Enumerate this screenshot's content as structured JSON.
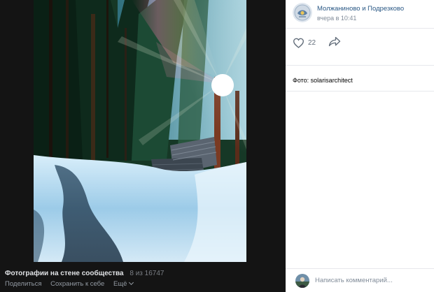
{
  "post": {
    "community_name": "Молжаниново и Подрезково",
    "time": "вчера в 10:41",
    "likes": "22",
    "caption": "Фото: solarisarchitect"
  },
  "viewer": {
    "album_title": "Фотографии на стене сообщества",
    "position": "8 из 16747",
    "share_label": "Поделиться",
    "save_label": "Сохранить к себе",
    "more_label": "Ещё"
  },
  "comment": {
    "placeholder": "Написать комментарий..."
  },
  "colors": {
    "viewer_bg": "#141414",
    "link": "#2a5885",
    "panel_bg": "#ffffff"
  },
  "icons": {
    "like": "heart-outline-icon",
    "share": "share-arrow-icon",
    "more": "chevron-down-icon"
  }
}
